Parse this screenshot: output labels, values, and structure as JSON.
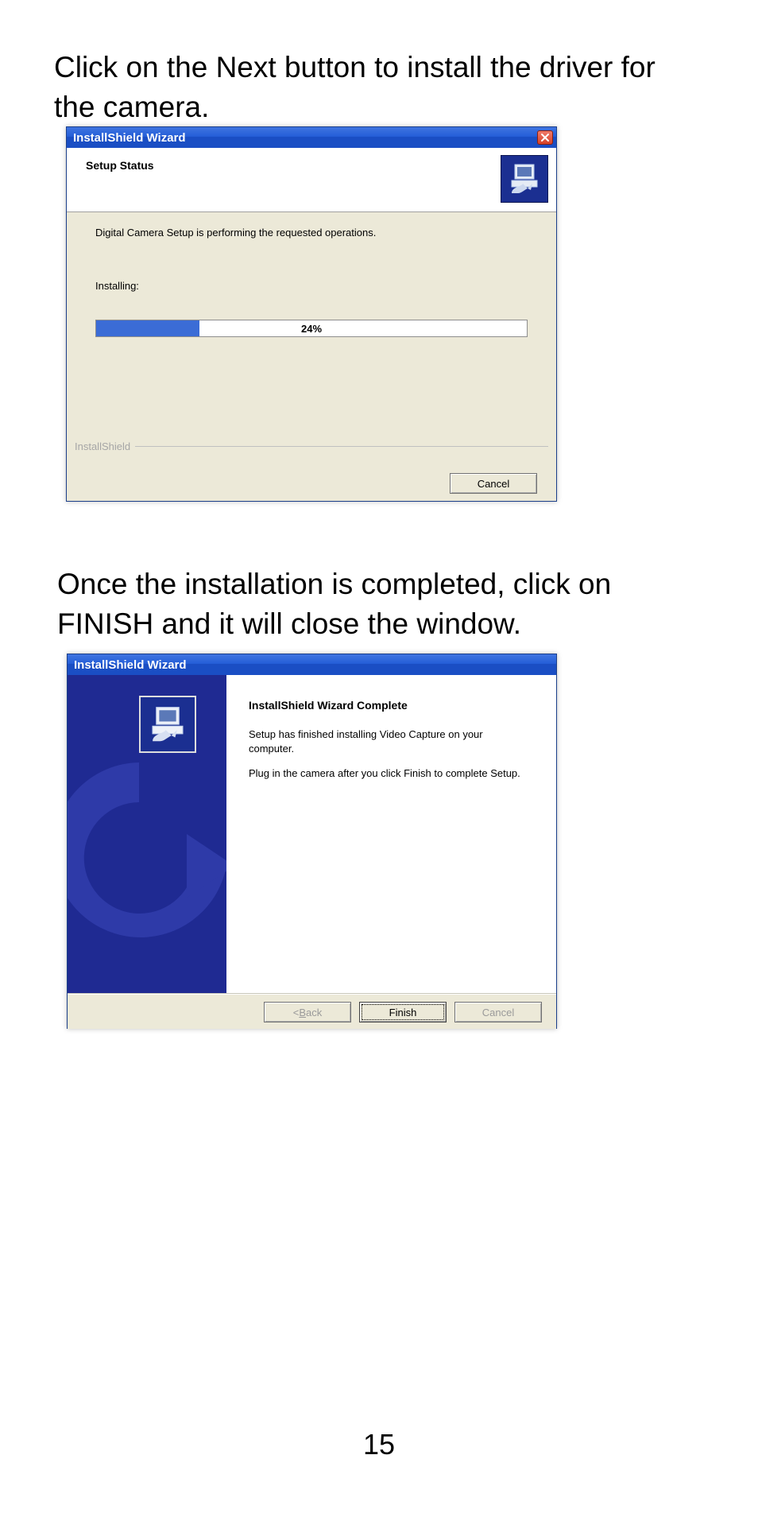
{
  "doc": {
    "intro1": "Click on the Next button to install the driver for the camera.",
    "intro2": "Once the installation is completed, click on FINISH and it will close the window.",
    "page_number": "15"
  },
  "dialog1": {
    "title": "InstallShield Wizard",
    "header_label": "Setup Status",
    "body_line1": "Digital Camera Setup is performing the requested operations.",
    "installing_label": "Installing:",
    "progress_percent": "24%",
    "progress_value": 24,
    "brand": "InstallShield",
    "cancel_label": "Cancel"
  },
  "dialog2": {
    "title": "InstallShield Wizard",
    "complete_title": "InstallShield Wizard Complete",
    "p1": "Setup has finished installing Video Capture on your computer.",
    "p2": "Plug in the camera after you click Finish to complete Setup.",
    "back_prefix": "< ",
    "back_u": "B",
    "back_rest": "ack",
    "finish_label": "Finish",
    "cancel_label": "Cancel"
  }
}
